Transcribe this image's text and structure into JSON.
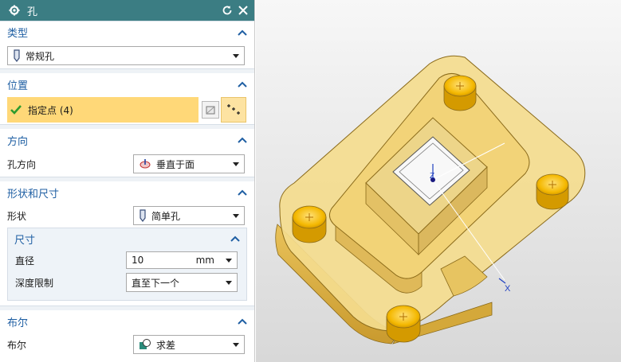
{
  "dialog": {
    "title": "孔",
    "sections": {
      "type": {
        "header": "类型",
        "selected": "常规孔"
      },
      "position": {
        "header": "位置",
        "point_label": "指定点 (4)"
      },
      "direction": {
        "header": "方向",
        "field_label": "孔方向",
        "selected": "垂直于面"
      },
      "shape": {
        "header": "形状和尺寸",
        "field_label": "形状",
        "selected": "简单孔",
        "dimensions": {
          "header": "尺寸",
          "diameter_label": "直径",
          "diameter_value": "10",
          "diameter_unit": "mm",
          "depth_label": "深度限制",
          "depth_value": "直至下一个"
        }
      },
      "boolean": {
        "header": "布尔",
        "field_label": "布尔",
        "selected": "求差"
      }
    }
  },
  "viewport": {
    "axis_x": "X",
    "axis_z": "Z"
  },
  "colors": {
    "titlebar": "#3b7d83",
    "section_header_text": "#1f5fa3",
    "selected_highlight": "#ffd878",
    "part_fill": "#f2d37a",
    "hole_marker": "#f4b800"
  }
}
